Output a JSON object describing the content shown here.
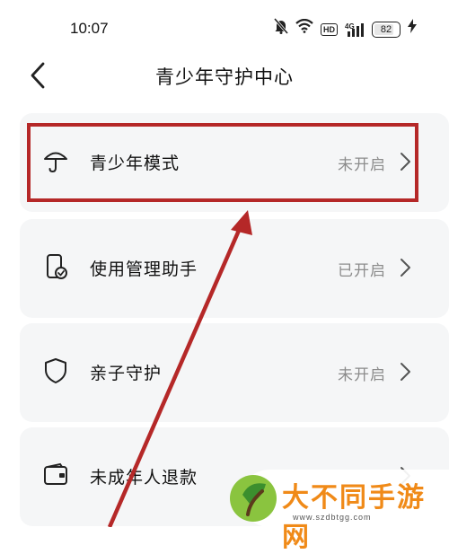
{
  "status_bar": {
    "time": "10:07",
    "icons": [
      "mute-icon",
      "wifi-icon",
      "hd-icon",
      "signal-4g-icon",
      "battery-icon",
      "charging-icon"
    ],
    "hd": "HD",
    "network": "4G",
    "battery": "82",
    "battery_level": 0.82
  },
  "header": {
    "title": "青少年守护中心",
    "back_icon": "chevron-left-icon"
  },
  "menu": [
    {
      "label": "青少年模式",
      "status": "未开启",
      "icon": "umbrella-icon"
    },
    {
      "label": "使用管理助手",
      "status": "已开启",
      "icon": "phone-check-icon"
    },
    {
      "label": "亲子守护",
      "status": "未开启",
      "icon": "shield-icon"
    },
    {
      "label": "未成年人退款",
      "status": "",
      "icon": "wallet-icon"
    }
  ],
  "annotation": {
    "color": "#b52828"
  },
  "watermark": {
    "title": "大不同手游网",
    "url": "www.szdbtgg.com"
  }
}
